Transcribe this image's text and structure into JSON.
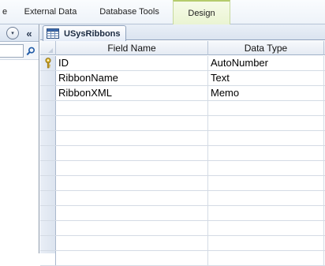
{
  "ribbon": {
    "tabs": [
      {
        "label": "e"
      },
      {
        "label": "External Data"
      },
      {
        "label": "Database Tools"
      },
      {
        "label": "Design",
        "contextual": true
      }
    ]
  },
  "nav_pane": {
    "dropdown_glyph": "▾",
    "collapse_glyph": "«",
    "search_value": "",
    "search_icon": "search-icon"
  },
  "document": {
    "tab_label": "USysRibbons",
    "tab_icon": "table-icon"
  },
  "design_grid": {
    "columns": [
      "Field Name",
      "Data Type",
      ""
    ],
    "rows": [
      {
        "field_name": "ID",
        "data_type": "AutoNumber",
        "primary_key": true
      },
      {
        "field_name": "RibbonName",
        "data_type": "Text",
        "primary_key": false
      },
      {
        "field_name": "RibbonXML",
        "data_type": "Memo",
        "primary_key": false
      },
      {
        "field_name": "",
        "data_type": "",
        "primary_key": false
      },
      {
        "field_name": "",
        "data_type": "",
        "primary_key": false
      },
      {
        "field_name": "",
        "data_type": "",
        "primary_key": false
      },
      {
        "field_name": "",
        "data_type": "",
        "primary_key": false
      },
      {
        "field_name": "",
        "data_type": "",
        "primary_key": false
      },
      {
        "field_name": "",
        "data_type": "",
        "primary_key": false
      },
      {
        "field_name": "",
        "data_type": "",
        "primary_key": false
      },
      {
        "field_name": "",
        "data_type": "",
        "primary_key": false
      },
      {
        "field_name": "",
        "data_type": "",
        "primary_key": false
      },
      {
        "field_name": "",
        "data_type": "",
        "primary_key": false
      },
      {
        "field_name": "",
        "data_type": "",
        "primary_key": false
      }
    ]
  },
  "colors": {
    "contextual_tab": "#eaf4d2",
    "grid_line": "#d4dbe5",
    "header_bg": "#e5ebf3"
  }
}
